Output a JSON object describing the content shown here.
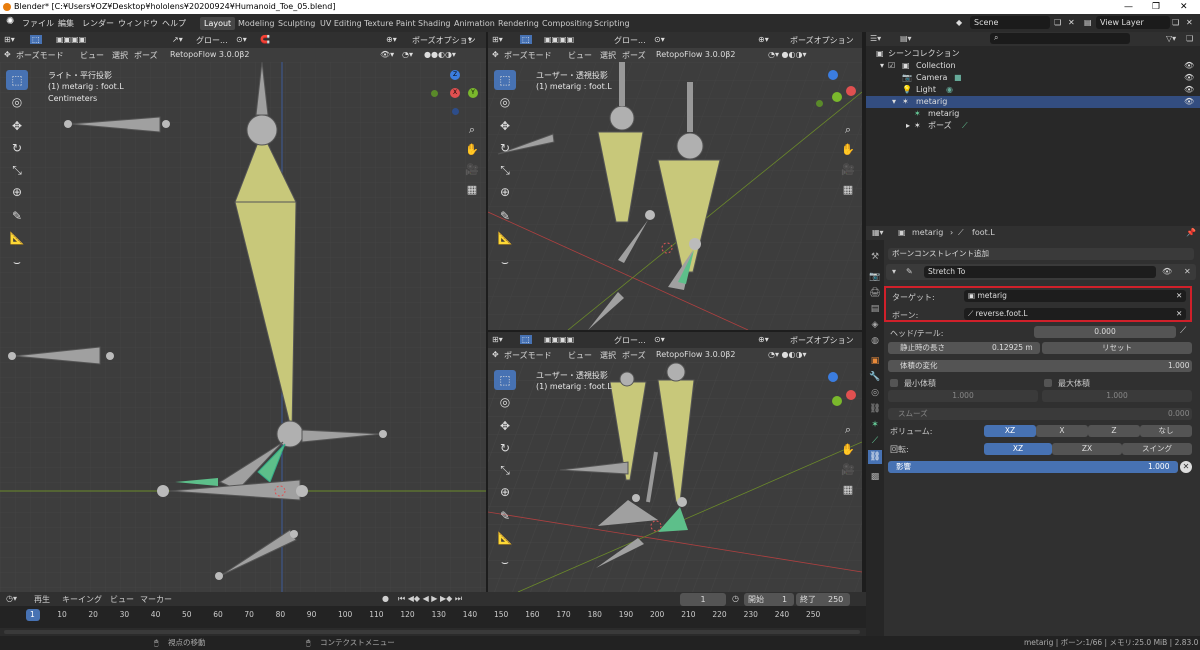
{
  "window": {
    "title": "Blender* [C:¥Users¥OZ¥Desktop¥hololens¥20200924¥Humanoid_Toe_05.blend]",
    "min": "—",
    "max": "❐",
    "close": "✕"
  },
  "menu": [
    "ファイル",
    "編集",
    "レンダー",
    "ウィンドウ",
    "ヘルプ"
  ],
  "workspaces": [
    "Layout",
    "Modeling",
    "Sculpting",
    "UV Editing",
    "Texture Paint",
    "Shading",
    "Animation",
    "Rendering",
    "Compositing",
    "Scripting"
  ],
  "active_workspace": "Layout",
  "scene": "Scene",
  "view_layer": "View Layer",
  "viewport_header": {
    "mode": "ポーズモード",
    "view": "ビュー",
    "select": "選択",
    "pose": "ポーズ",
    "addon": "RetopoFlow 3.0.0β2",
    "global": "グロー...",
    "pose_options": "ポーズオプション"
  },
  "viewports": [
    {
      "view": "ライト・平行投影",
      "object": "(1) metarig : foot.L",
      "units": "Centimeters"
    },
    {
      "view": "ユーザー・透視投影",
      "object": "(1) metarig : foot.L"
    },
    {
      "view": "ユーザー・透視投影",
      "object": "(1) metarig : foot.L"
    }
  ],
  "gizmo": {
    "z": "Z",
    "y": "Y",
    "x": "X"
  },
  "outliner": {
    "search_icon": "search-icon",
    "rows": [
      {
        "label": "シーンコレクション",
        "indent": 0
      },
      {
        "label": "Collection",
        "indent": 1
      },
      {
        "label": "Camera",
        "indent": 2
      },
      {
        "label": "Light",
        "indent": 2
      },
      {
        "label": "metarig",
        "indent": 2,
        "selected": true
      },
      {
        "label": "metarig",
        "indent": 3
      },
      {
        "label": "ポーズ",
        "indent": 3
      }
    ]
  },
  "properties": {
    "breadcrumb_object": "metarig",
    "breadcrumb_bone": "foot.L",
    "add_constraint": "ボーンコンストレイント追加",
    "constraint_name": "Stretch To",
    "target_label": "ターゲット:",
    "target_value": "metarig",
    "bone_label": "ボーン:",
    "bone_value": "reverse.foot.L",
    "head_tail_label": "ヘッド/テール:",
    "head_tail_value": "0.000",
    "rest_length_label": "静止時の長さ",
    "rest_length_value": "0.12925 m",
    "reset_label": "リセット",
    "volume_variation_label": "体積の変化",
    "volume_variation_value": "1.000",
    "vol_min_label": "最小体積",
    "vol_max_label": "最大体積",
    "vol_min_value": "1.000",
    "vol_max_value": "1.000",
    "smooth_label": "スムーズ",
    "smooth_value": "0.000",
    "volume_label": "ボリューム:",
    "volume_options": [
      "XZ",
      "X",
      "Z",
      "なし"
    ],
    "volume_selected": "XZ",
    "rotation_label": "回転:",
    "rotation_options": [
      "XZ",
      "ZX",
      "スイング"
    ],
    "rotation_selected": "XZ",
    "influence_label": "影響",
    "influence_value": "1.000",
    "influence_fraction": 1.0
  },
  "timeline": {
    "menus": [
      "再生",
      "キーイング",
      "ビュー",
      "マーカー"
    ],
    "current_frame": "1",
    "start_label": "開始",
    "start_value": "1",
    "end_label": "終了",
    "end_value": "250",
    "ticks": [
      "1",
      "10",
      "20",
      "30",
      "40",
      "50",
      "60",
      "70",
      "80",
      "90",
      "100",
      "110",
      "120",
      "130",
      "140",
      "150",
      "160",
      "170",
      "180",
      "190",
      "200",
      "210",
      "220",
      "230",
      "240",
      "250"
    ]
  },
  "status": {
    "left": "視点の移動",
    "mid": "コンテクストメニュー",
    "right": "metarig | ボーン:1/66 | メモリ:25.0 MiB | 2.83.0"
  },
  "colors": {
    "accent": "#4772b3",
    "highlight_box": "#d0202a",
    "bone_yellow": "#c8c87a",
    "bone_gray": "#a0a0a0",
    "bone_green": "#5dbf8a"
  }
}
